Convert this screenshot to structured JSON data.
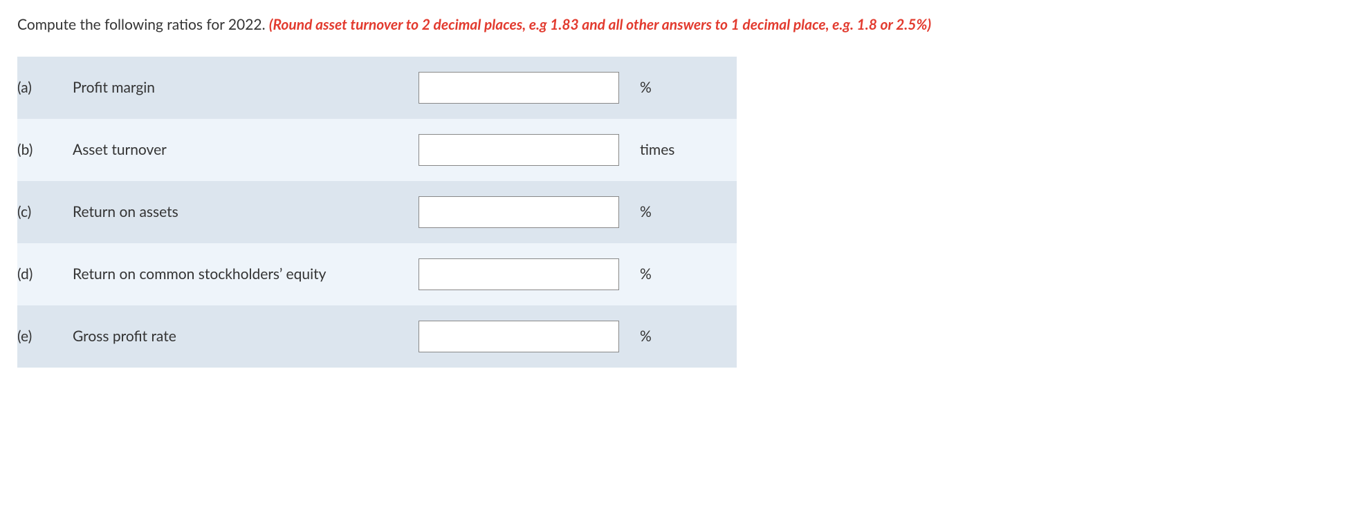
{
  "instruction": {
    "black": "Compute the following ratios for 2022. ",
    "red": "(Round asset turnover to 2 decimal places, e.g 1.83 and all other answers to 1 decimal place, e.g. 1.8 or 2.5%)"
  },
  "rows": [
    {
      "label": "(a)",
      "name": "Profit margin",
      "value": "",
      "unit": "%"
    },
    {
      "label": "(b)",
      "name": "Asset turnover",
      "value": "",
      "unit": "times"
    },
    {
      "label": "(c)",
      "name": "Return on assets",
      "value": "",
      "unit": "%"
    },
    {
      "label": "(d)",
      "name": "Return on common stockholders’ equity",
      "value": "",
      "unit": "%"
    },
    {
      "label": "(e)",
      "name": "Gross profit rate",
      "value": "",
      "unit": "%"
    }
  ]
}
